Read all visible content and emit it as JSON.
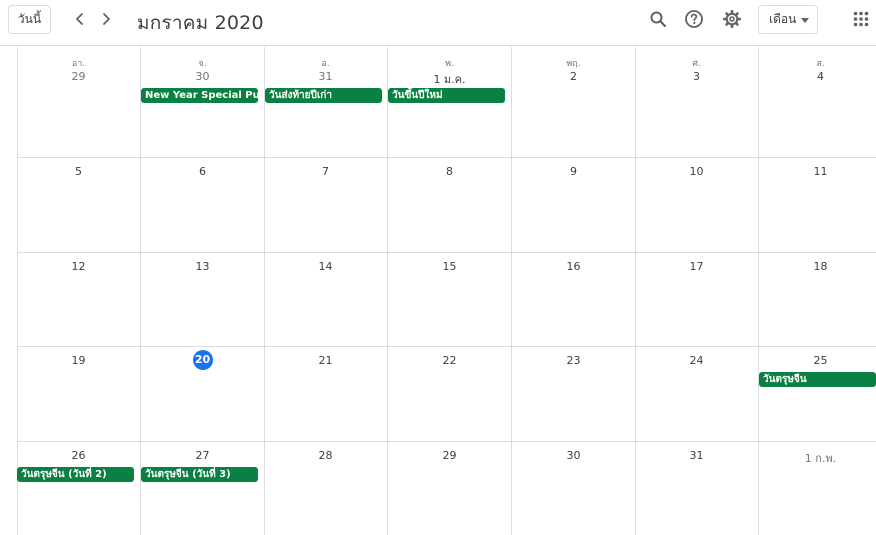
{
  "header": {
    "today_label": "วันนี้",
    "title": "มกราคม 2020",
    "view_label": "เดือน",
    "icons": {
      "prev": "chevron-left-icon",
      "next": "chevron-right-icon",
      "search": "search-icon",
      "help": "help-icon",
      "settings": "gear-icon",
      "caret": "caret-down-icon",
      "apps": "apps-grid-icon"
    }
  },
  "colors": {
    "today_bg": "#1a73e8",
    "event_bg": "#0b8043",
    "grid_line": "#dadce0",
    "text": "#3c4043"
  },
  "weekdays": [
    "อา.",
    "จ.",
    "อ.",
    "พ.",
    "พฤ.",
    "ศ.",
    "ส."
  ],
  "weeks": [
    [
      "29",
      "30",
      "31",
      "1 ม.ค.",
      "2",
      "3",
      "4"
    ],
    [
      "5",
      "6",
      "7",
      "8",
      "9",
      "10",
      "11"
    ],
    [
      "12",
      "13",
      "14",
      "15",
      "16",
      "17",
      "18"
    ],
    [
      "19",
      "20",
      "21",
      "22",
      "23",
      "24",
      "25"
    ],
    [
      "26",
      "27",
      "28",
      "29",
      "30",
      "31",
      "1 ก.พ."
    ]
  ],
  "today": "20",
  "events": {
    "e1": "New Year Special Public",
    "e2": "วันส่งท้ายปีเก่า",
    "e3": "วันขึ้นปีใหม่",
    "e4": "วันตรุษจีน",
    "e5": "วันตรุษจีน (วันที่ 2)",
    "e6": "วันตรุษจีน (วันที่ 3)"
  }
}
